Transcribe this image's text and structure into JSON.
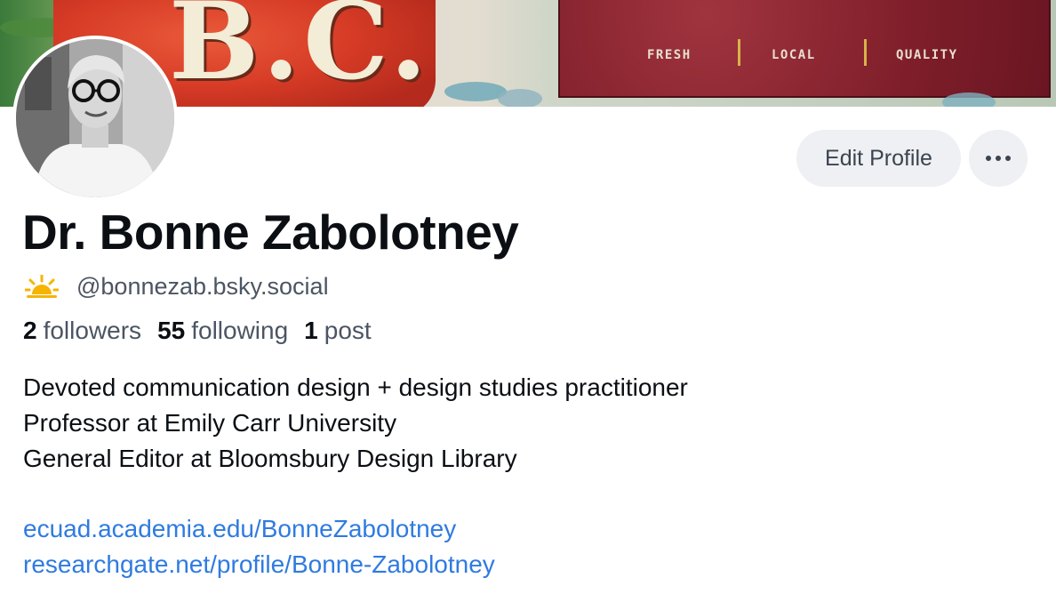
{
  "banner": {
    "sign_items": [
      "FRESH",
      "LOCAL",
      "QUALITY"
    ],
    "can_text": "B.C."
  },
  "profile": {
    "display_name": "Dr. Bonne Zabolotney",
    "handle": "@bonnezab.bsky.social",
    "handle_icon": "sun-icon",
    "stats": {
      "followers_count": "2",
      "followers_label": "followers",
      "following_count": "55",
      "following_label": "following",
      "posts_count": "1",
      "posts_label": "post"
    },
    "bio_lines": [
      "Devoted communication design + design studies practitioner",
      "Professor at Emily Carr University",
      "General Editor at Bloomsbury Design Library"
    ],
    "links": [
      "ecuad.academia.edu/BonneZabolotney",
      "researchgate.net/profile/Bonne-Zabolotney"
    ]
  },
  "actions": {
    "edit_profile_label": "Edit Profile",
    "more_icon": "more-horizontal-icon"
  },
  "colors": {
    "link": "#2f7be0",
    "muted_text": "#4b5563",
    "button_bg": "#eef0f3",
    "sun": "#f5b400"
  }
}
